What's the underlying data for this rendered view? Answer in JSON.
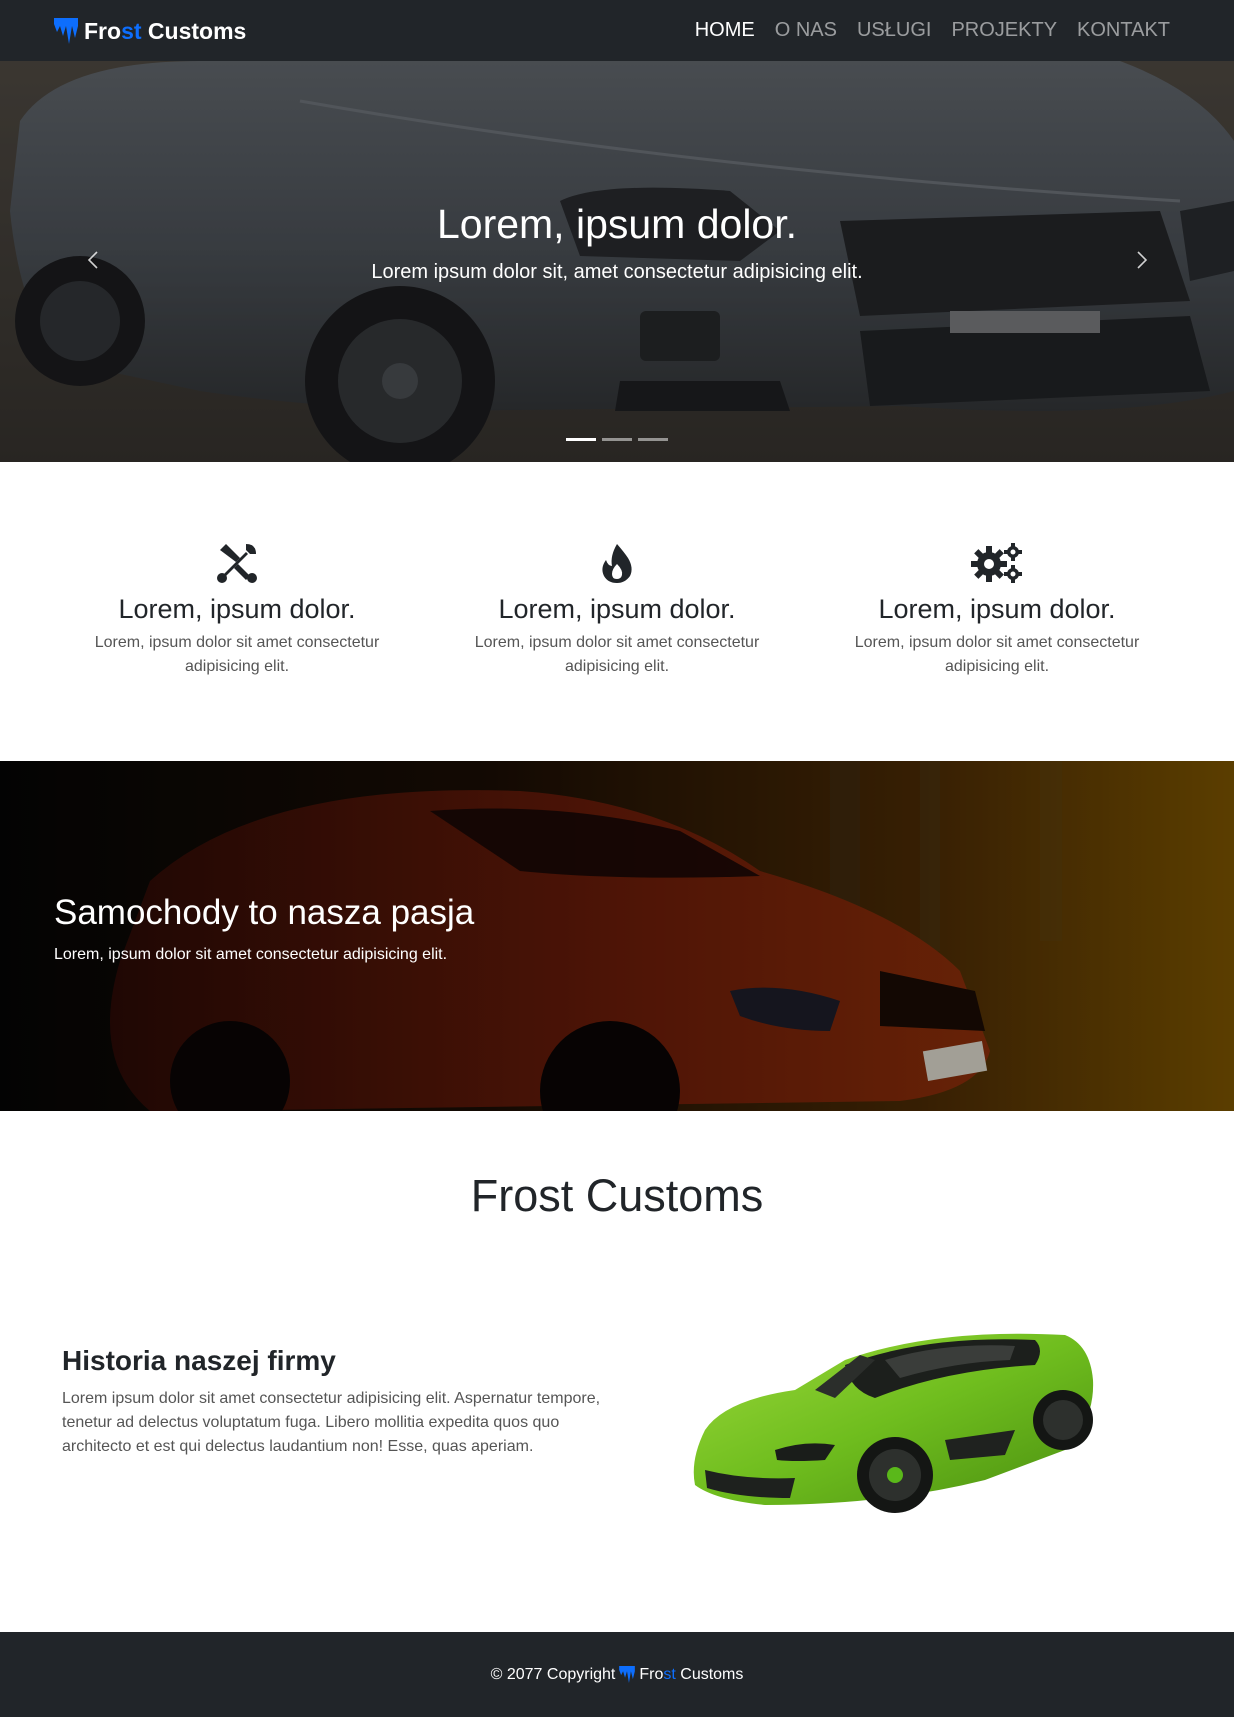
{
  "navbar": {
    "brand_pre": "Fro",
    "brand_hl": "st",
    "brand_post": " Customs",
    "links": [
      {
        "label": "HOME",
        "active": true
      },
      {
        "label": "O NAS",
        "active": false
      },
      {
        "label": "USŁUGI",
        "active": false
      },
      {
        "label": "PROJEKTY",
        "active": false
      },
      {
        "label": "KONTAKT",
        "active": false
      }
    ],
    "accent": "#0d6efd",
    "bg": "#212529"
  },
  "hero": {
    "title": "Lorem, ipsum dolor.",
    "text": "Lorem ipsum dolor sit, amet consectetur adipisicing elit.",
    "prev_icon": "chevron-left-icon",
    "next_icon": "chevron-right-icon",
    "slides": 3,
    "active_slide": 1
  },
  "features": [
    {
      "icon": "tools-icon",
      "title": "Lorem, ipsum dolor.",
      "text": "Lorem, ipsum dolor sit amet consectetur adipisicing elit."
    },
    {
      "icon": "fire-icon",
      "title": "Lorem, ipsum dolor.",
      "text": "Lorem, ipsum dolor sit amet consectetur adipisicing elit."
    },
    {
      "icon": "gears-icon",
      "title": "Lorem, ipsum dolor.",
      "text": "Lorem, ipsum dolor sit amet consectetur adipisicing elit."
    }
  ],
  "banner": {
    "title": "Samochody to nasza pasja",
    "text": "Lorem, ipsum dolor sit amet consectetur adipisicing elit."
  },
  "about": {
    "title": "Frost Customs",
    "history_title": "Historia naszej firmy",
    "history_text": "Lorem ipsum dolor sit amet consectetur adipisicing elit. Aspernatur tempore, tenetur ad delectus voluptatum fuga. Libero mollitia expedita quos quo architecto et est qui delectus laudantium non! Esse, quas aperiam."
  },
  "footer": {
    "copyright": "© 2077 Copyright",
    "brand_pre": "Fro",
    "brand_hl": "st",
    "brand_post": " Customs"
  }
}
